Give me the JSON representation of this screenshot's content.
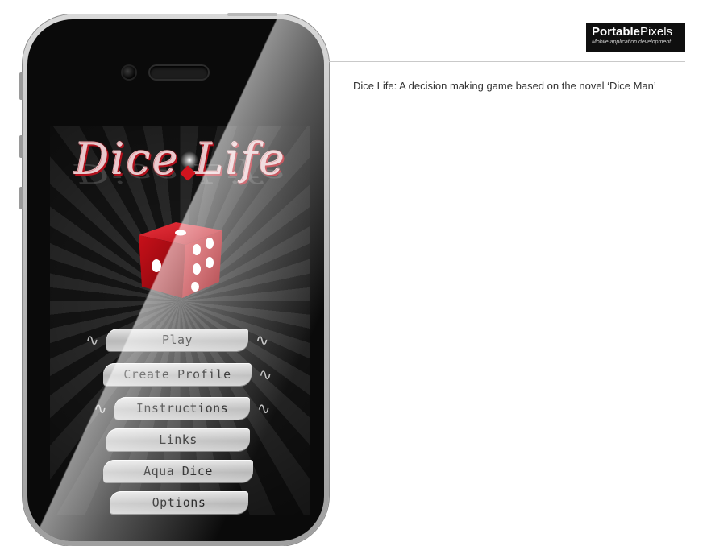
{
  "brand": {
    "name_bold": "Portable",
    "name_light": "Pixels",
    "tagline": "Mobile application development"
  },
  "caption": "Dice Life: A decision making game based on the novel ‘Dice Man’",
  "app": {
    "logo_text": "Dice Life",
    "die_icon": "red-die-icon",
    "menu": [
      {
        "label": "Play"
      },
      {
        "label": "Create Profile"
      },
      {
        "label": "Instructions"
      },
      {
        "label": "Links"
      },
      {
        "label": "Aqua Dice"
      },
      {
        "label": "Options"
      }
    ]
  },
  "colors": {
    "die_red": "#c8101a",
    "logo_red": "#b0121e",
    "brand_bg": "#0f0f0f",
    "button_gray": "#c9c9c9"
  }
}
